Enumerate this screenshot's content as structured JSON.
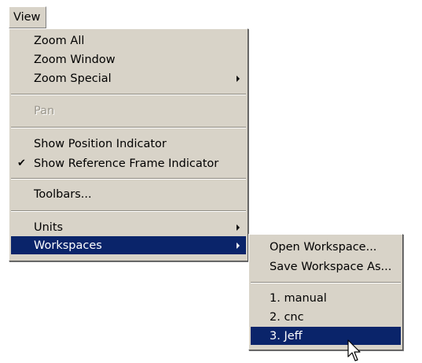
{
  "menubar": {
    "view_label": "View"
  },
  "view_menu": {
    "zoom_all": "Zoom All",
    "zoom_window": "Zoom Window",
    "zoom_special": "Zoom Special",
    "pan": "Pan",
    "show_position_indicator": "Show Position Indicator",
    "show_reference_frame_indicator": "Show Reference Frame Indicator",
    "toolbars": "Toolbars...",
    "units": "Units",
    "workspaces": "Workspaces"
  },
  "workspaces_menu": {
    "open_workspace": "Open Workspace...",
    "save_workspace_as": "Save Workspace As...",
    "recent": [
      "1. manual",
      "2. cnc",
      "3. Jeff"
    ]
  },
  "icons": {
    "check": "checkmark-icon",
    "submenu": "submenu-arrow-icon",
    "cursor": "mouse-pointer-icon"
  },
  "colors": {
    "menu_bg": "#d8d3c8",
    "highlight": "#0a246a",
    "highlight_text": "#ffffff",
    "disabled_text": "#9a968c"
  }
}
